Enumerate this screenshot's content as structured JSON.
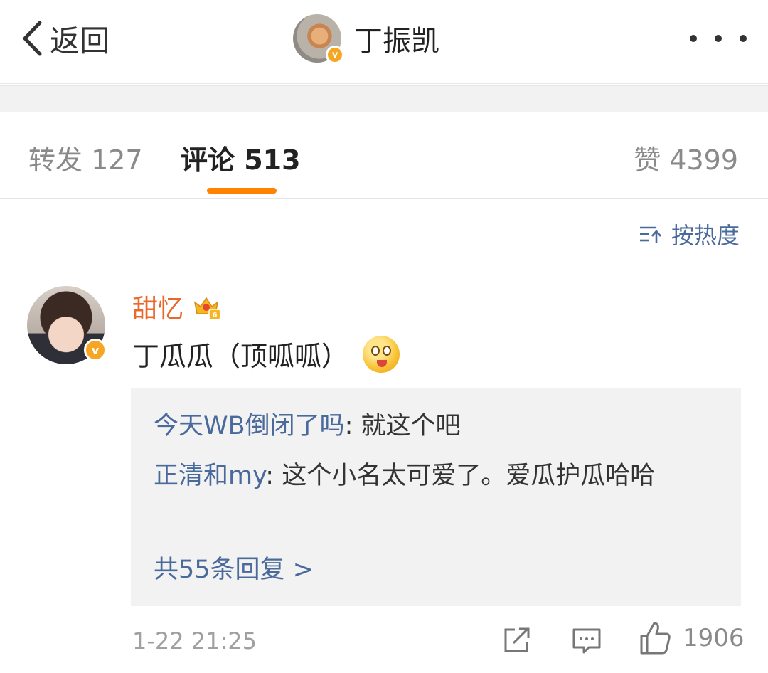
{
  "nav": {
    "back_label": "返回",
    "title": "丁振凯"
  },
  "tabs": {
    "repost": "转发 127",
    "comment": "评论 513",
    "like": "赞 4399"
  },
  "sort_label": "按热度",
  "comment": {
    "username": "甜忆",
    "text": "丁瓜瓜（顶呱呱）",
    "replies": [
      {
        "name": "今天WB倒闭了吗",
        "text": "就这个吧"
      },
      {
        "name": "正清和my",
        "text": "这个小名太可爱了。爱瓜护瓜哈哈"
      }
    ],
    "more_replies": "共55条回复 >",
    "time": "1-22 21:25",
    "like_count": "1906"
  },
  "colors": {
    "accent": "#ff8200",
    "link": "#4a6a9c",
    "username": "#e8692b",
    "verified": "#f6a623"
  },
  "icons": [
    "back-chevron-icon",
    "more-icon",
    "sort-icon",
    "vip-crown-icon",
    "emoji-icon",
    "share-icon",
    "comment-icon",
    "thumbs-up-icon"
  ]
}
